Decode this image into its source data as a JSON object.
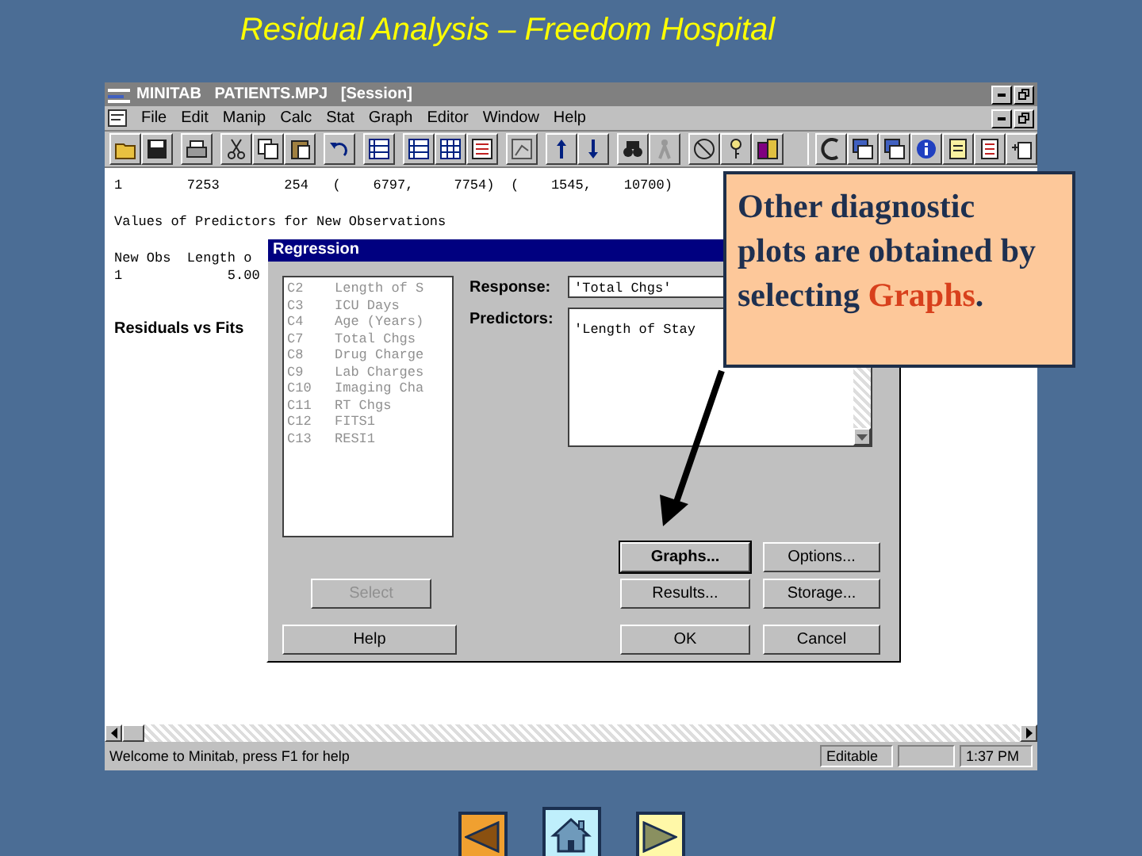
{
  "slide": {
    "title": "Residual Analysis – Freedom Hospital"
  },
  "window": {
    "title": "MINITAB   PATIENTS.MPJ   [Session]",
    "menu": [
      "File",
      "Edit",
      "Manip",
      "Calc",
      "Stat",
      "Graph",
      "Editor",
      "Window",
      "Help"
    ]
  },
  "session": {
    "lines": [
      {
        "kind": "text",
        "text": "1        7253        254   (    6797,     7754)  (    1545,    10700)"
      },
      {
        "kind": "text",
        "text": "Values of Predictors for New Observations"
      },
      {
        "kind": "text",
        "text": "New Obs  Length o"
      },
      {
        "kind": "text",
        "text": "1             5.00"
      },
      {
        "kind": "heading",
        "text": "Residuals vs Fits"
      }
    ]
  },
  "dialog": {
    "title": "Regression",
    "variables": {
      "disabled": true,
      "items": [
        {
          "column": "C2",
          "name": "Length of S"
        },
        {
          "column": "C3",
          "name": "ICU Days"
        },
        {
          "column": "C4",
          "name": "Age (Years)"
        },
        {
          "column": "C7",
          "name": "Total Chgs"
        },
        {
          "column": "C8",
          "name": "Drug Charge"
        },
        {
          "column": "C9",
          "name": "Lab Charges"
        },
        {
          "column": "C10",
          "name": "Imaging Cha"
        },
        {
          "column": "C11",
          "name": "RT Chgs"
        },
        {
          "column": "C12",
          "name": "FITS1"
        },
        {
          "column": "C13",
          "name": "RESI1"
        }
      ]
    },
    "response": {
      "label": "Response:",
      "value": "'Total Chgs'"
    },
    "predictors": {
      "label": "Predictors:",
      "value": "'Length of Stay"
    },
    "left_buttons": [
      {
        "label": "Select",
        "disabled": true,
        "default": false
      },
      {
        "label": "Help",
        "disabled": false,
        "default": false
      }
    ],
    "right_buttons": [
      {
        "label": "Graphs...",
        "disabled": false,
        "default": true
      },
      {
        "label": "Options...",
        "disabled": false,
        "default": false
      },
      {
        "label": "Results...",
        "disabled": false,
        "default": false
      },
      {
        "label": "Storage...",
        "disabled": false,
        "default": false
      },
      {
        "label": "OK",
        "disabled": false,
        "default": false
      },
      {
        "label": "Cancel",
        "disabled": false,
        "default": false
      }
    ]
  },
  "status_bar": {
    "message": "Welcome to Minitab, press F1 for help",
    "mode": "Editable",
    "time": "1:37 PM"
  },
  "callout": {
    "text": "Other diagnostic plots are obtained by selecting ",
    "highlight": "Graphs",
    "end": "."
  },
  "nav": [
    {
      "kind": "prev"
    },
    {
      "kind": "home"
    },
    {
      "kind": "next"
    }
  ]
}
